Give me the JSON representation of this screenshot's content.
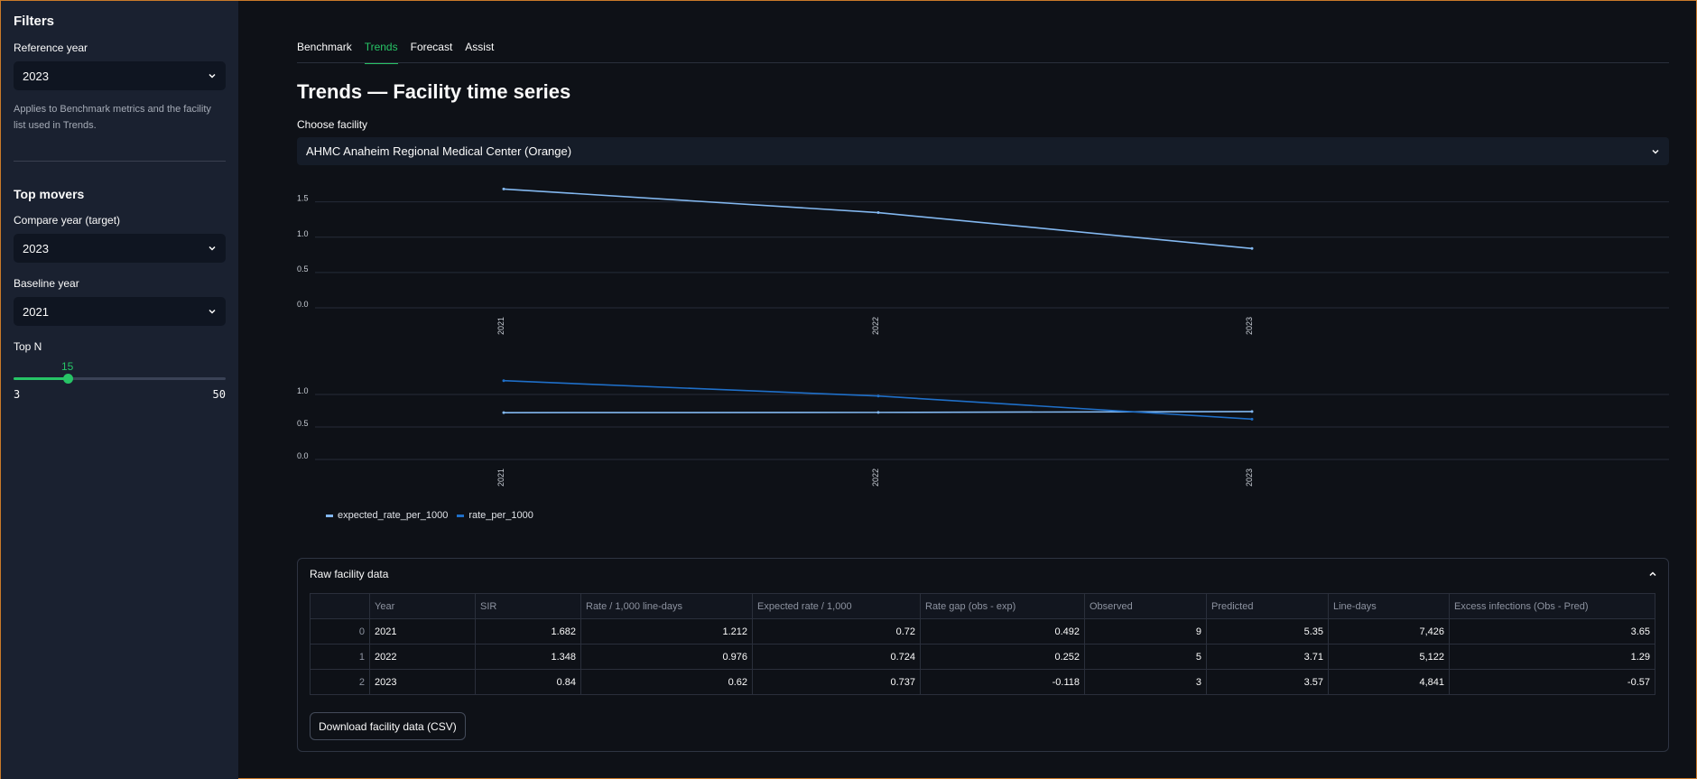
{
  "sidebar": {
    "filters_title": "Filters",
    "reference_year_label": "Reference year",
    "reference_year_value": "2023",
    "reference_note": "Applies to Benchmark metrics and the facility list used in Trends.",
    "top_movers_title": "Top movers",
    "compare_year_label": "Compare year (target)",
    "compare_year_value": "2023",
    "baseline_year_label": "Baseline year",
    "baseline_year_value": "2021",
    "topn_label": "Top N",
    "topn_value": "15",
    "topn_min": "3",
    "topn_max": "50",
    "topn_fraction": 0.255
  },
  "tabs": [
    {
      "label": "Benchmark",
      "active": false
    },
    {
      "label": "Trends",
      "active": true
    },
    {
      "label": "Forecast",
      "active": false
    },
    {
      "label": "Assist",
      "active": false
    }
  ],
  "main": {
    "title": "Trends — Facility time series",
    "facility_label": "Choose facility",
    "facility_value": "AHMC Anaheim Regional Medical Center (Orange)"
  },
  "chart_data": [
    {
      "type": "line",
      "x": [
        "2021",
        "2022",
        "2023"
      ],
      "series": [
        {
          "values": [
            1.682,
            1.348,
            0.84
          ],
          "color": "#83b8f0"
        }
      ],
      "yticks": [
        "0.0",
        "0.5",
        "1.0",
        "1.5"
      ],
      "ylim": [
        0,
        1.7
      ],
      "grid": true
    },
    {
      "type": "line",
      "x": [
        "2021",
        "2022",
        "2023"
      ],
      "series": [
        {
          "name": "expected_rate_per_1000",
          "values": [
            0.72,
            0.724,
            0.737
          ],
          "color": "#83b8f0"
        },
        {
          "name": "rate_per_1000",
          "values": [
            1.212,
            0.976,
            0.62
          ],
          "color": "#1f6fc8"
        }
      ],
      "yticks": [
        "0.0",
        "0.5",
        "1.0"
      ],
      "ylim": [
        0,
        1.25
      ],
      "grid": true,
      "legend": "bottom-left"
    }
  ],
  "raw": {
    "title": "Raw facility data",
    "columns": [
      "",
      "Year",
      "SIR",
      "Rate / 1,000 line-days",
      "Expected rate / 1,000",
      "Rate gap (obs - exp)",
      "Observed",
      "Predicted",
      "Line-days",
      "Excess infections (Obs - Pred)"
    ],
    "rows": [
      [
        "0",
        "2021",
        "1.682",
        "1.212",
        "0.72",
        "0.492",
        "9",
        "5.35",
        "7,426",
        "3.65"
      ],
      [
        "1",
        "2022",
        "1.348",
        "0.976",
        "0.724",
        "0.252",
        "5",
        "3.71",
        "5,122",
        "1.29"
      ],
      [
        "2",
        "2023",
        "0.84",
        "0.62",
        "0.737",
        "-0.118",
        "3",
        "3.57",
        "4,841",
        "-0.57"
      ]
    ],
    "download_label": "Download facility data (CSV)"
  }
}
